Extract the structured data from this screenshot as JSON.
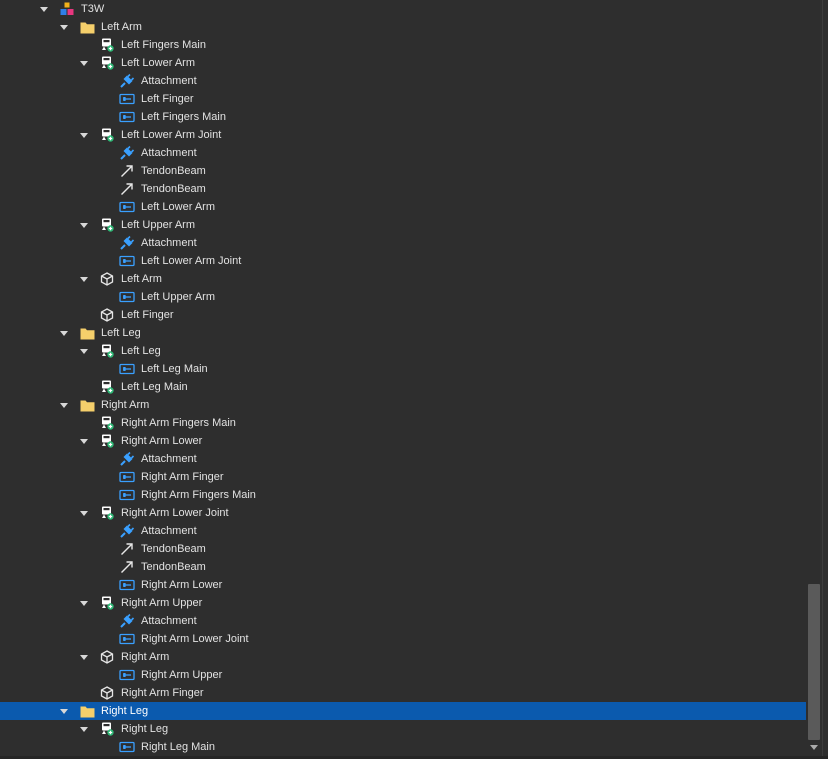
{
  "colors": {
    "background": "#2e2e2e",
    "selection": "#0b5aae",
    "text": "#e2e2e2",
    "folder": "#f5cf6b",
    "motor_blue": "#3aa0ff",
    "attachment_blue": "#3aa0ff",
    "beam_white": "#e8e8e8"
  },
  "tree": [
    {
      "label": "T3W",
      "icon": "model-icon",
      "depth": 0,
      "expanded": true
    },
    {
      "label": "Left Arm",
      "icon": "folder-icon",
      "depth": 1,
      "expanded": true
    },
    {
      "label": "Left Fingers Main",
      "icon": "part-icon",
      "depth": 2
    },
    {
      "label": "Left Lower Arm",
      "icon": "part-icon",
      "depth": 2,
      "expanded": true
    },
    {
      "label": "Attachment",
      "icon": "attachment-icon",
      "depth": 3
    },
    {
      "label": "Left Finger",
      "icon": "weld-icon",
      "depth": 3
    },
    {
      "label": "Left Fingers Main",
      "icon": "weld-icon",
      "depth": 3
    },
    {
      "label": "Left Lower Arm Joint",
      "icon": "part-icon",
      "depth": 2,
      "expanded": true
    },
    {
      "label": "Attachment",
      "icon": "attachment-icon",
      "depth": 3
    },
    {
      "label": "TendonBeam",
      "icon": "beam-icon",
      "depth": 3
    },
    {
      "label": "TendonBeam",
      "icon": "beam-icon",
      "depth": 3
    },
    {
      "label": "Left Lower Arm",
      "icon": "weld-icon",
      "depth": 3
    },
    {
      "label": "Left Upper Arm",
      "icon": "part-icon",
      "depth": 2,
      "expanded": true
    },
    {
      "label": "Attachment",
      "icon": "attachment-icon",
      "depth": 3
    },
    {
      "label": "Left Lower Arm Joint",
      "icon": "weld-icon",
      "depth": 3
    },
    {
      "label": "Left Arm",
      "icon": "box-icon",
      "depth": 2,
      "expanded": true
    },
    {
      "label": "Left Upper Arm",
      "icon": "weld-icon",
      "depth": 3
    },
    {
      "label": "Left Finger",
      "icon": "box-icon",
      "depth": 2
    },
    {
      "label": "Left Leg",
      "icon": "folder-icon",
      "depth": 1,
      "expanded": true
    },
    {
      "label": "Left Leg",
      "icon": "part-icon",
      "depth": 2,
      "expanded": true
    },
    {
      "label": "Left Leg Main",
      "icon": "weld-icon",
      "depth": 3
    },
    {
      "label": "Left Leg Main",
      "icon": "part-icon",
      "depth": 2
    },
    {
      "label": "Right Arm",
      "icon": "folder-icon",
      "depth": 1,
      "expanded": true
    },
    {
      "label": "Right Arm Fingers Main",
      "icon": "part-icon",
      "depth": 2
    },
    {
      "label": "Right Arm Lower",
      "icon": "part-icon",
      "depth": 2,
      "expanded": true
    },
    {
      "label": "Attachment",
      "icon": "attachment-icon",
      "depth": 3
    },
    {
      "label": "Right Arm Finger",
      "icon": "weld-icon",
      "depth": 3
    },
    {
      "label": "Right Arm Fingers Main",
      "icon": "weld-icon",
      "depth": 3
    },
    {
      "label": "Right Arm Lower Joint",
      "icon": "part-icon",
      "depth": 2,
      "expanded": true
    },
    {
      "label": "Attachment",
      "icon": "attachment-icon",
      "depth": 3
    },
    {
      "label": "TendonBeam",
      "icon": "beam-icon",
      "depth": 3
    },
    {
      "label": "TendonBeam",
      "icon": "beam-icon",
      "depth": 3
    },
    {
      "label": "Right Arm Lower",
      "icon": "weld-icon",
      "depth": 3
    },
    {
      "label": "Right Arm Upper",
      "icon": "part-icon",
      "depth": 2,
      "expanded": true
    },
    {
      "label": "Attachment",
      "icon": "attachment-icon",
      "depth": 3
    },
    {
      "label": "Right Arm Lower Joint",
      "icon": "weld-icon",
      "depth": 3
    },
    {
      "label": "Right Arm",
      "icon": "box-icon",
      "depth": 2,
      "expanded": true
    },
    {
      "label": "Right Arm Upper",
      "icon": "weld-icon",
      "depth": 3
    },
    {
      "label": "Right Arm Finger",
      "icon": "box-icon",
      "depth": 2
    },
    {
      "label": "Right Leg",
      "icon": "folder-icon",
      "depth": 1,
      "expanded": true,
      "selected": true
    },
    {
      "label": "Right Leg",
      "icon": "part-icon",
      "depth": 2,
      "expanded": true
    },
    {
      "label": "Right Leg Main",
      "icon": "weld-icon",
      "depth": 3
    }
  ]
}
